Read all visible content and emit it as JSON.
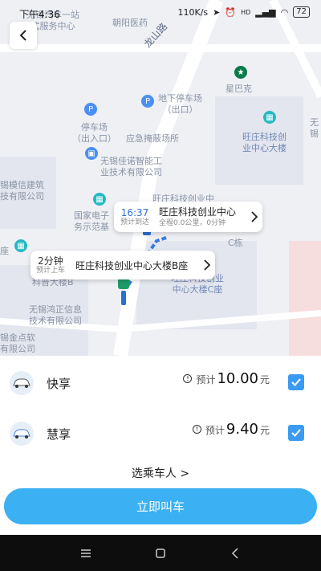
{
  "status_bar": {
    "time": "下午4:36",
    "speed": "110K/s",
    "network": "HD",
    "battery": "72"
  },
  "map": {
    "labels": {
      "top_left": "无锡汽车一站\n式服务中心",
      "hospital": "朝阳医药",
      "road": "龙山路",
      "starbucks": "星巴克",
      "parking_underground": "地下停车场\n（出口）",
      "parking_entrance": "停车场\n（出入口）",
      "shelter": "应急掩蔽场所",
      "jianuo": "无锡佳诺智能工\n业技术有限公司",
      "wangzhuang_tower": "旺庄科技创\n业中心大楼",
      "building_design": "锡模信建筑\n技有限公司",
      "center_top": "旺庄科技创业中",
      "national_center": "国家电子\n务示范基",
      "c_building": "C栋",
      "c_building2": "旺庄科技创业\n中心大楼C座",
      "hongzheng": "无锡鸿正信息\n技术有限公司",
      "left_bottom": "锡金点软\n有限公司",
      "left_edge": "座",
      "b_building": "科普大楼B",
      "right_edge": "无\n锡"
    }
  },
  "destination": {
    "eta_time": "16:37",
    "eta_label": "预计到达",
    "name": "旺庄科技创业中心",
    "detail": "全程0.0公里，0分钟"
  },
  "pickup": {
    "minutes": "2分钟",
    "minutes_label": "预计上车",
    "name": "旺庄科技创业中心大楼B座"
  },
  "cars": [
    {
      "name": "快享",
      "est_label": "预计",
      "price": "10.00",
      "unit": "元",
      "checked": true
    },
    {
      "name": "慧享",
      "est_label": "预计",
      "price": "9.40",
      "unit": "元",
      "checked": true
    }
  ],
  "passenger_link": "选乘车人 >",
  "call_button": "立即叫车",
  "colors": {
    "accent": "#3bb0f2",
    "checkbox": "#3b9bf2",
    "eta_blue": "#2f6fd6"
  }
}
